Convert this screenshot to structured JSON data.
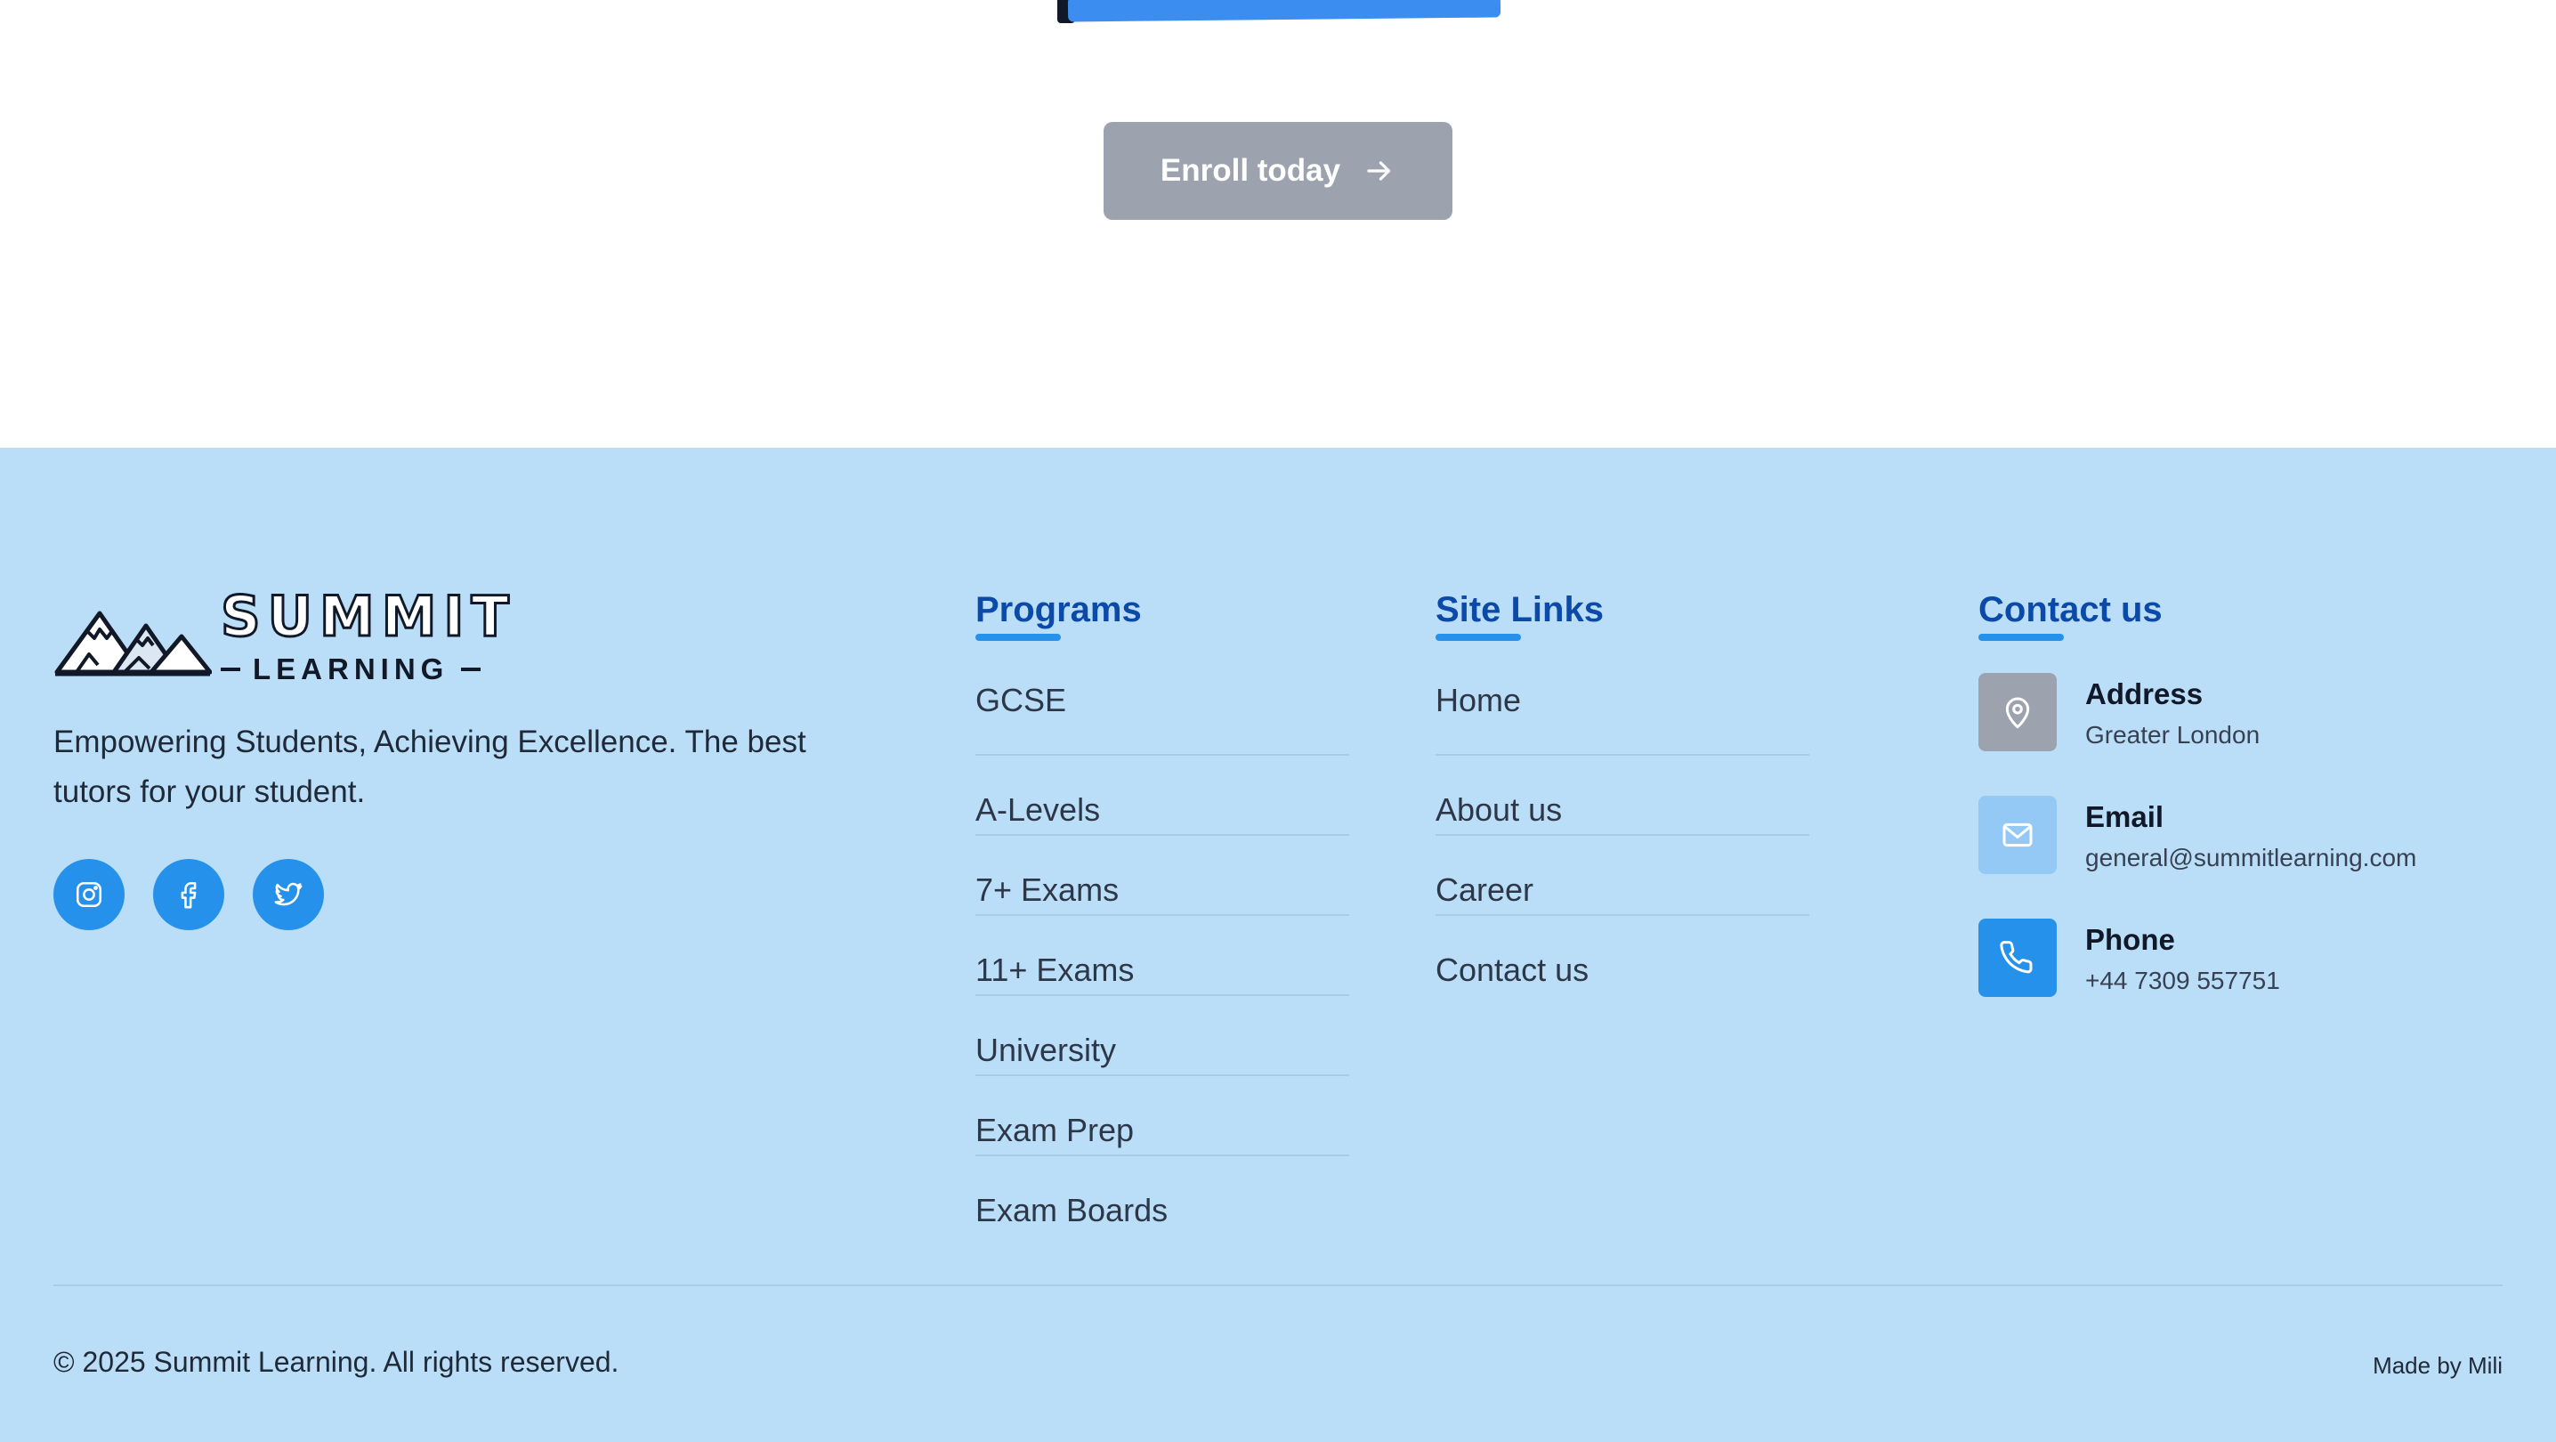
{
  "hero": {
    "enroll_label": "Enroll today"
  },
  "footer": {
    "brand": {
      "logo_line1": "SUMMIT",
      "logo_line2": "LEARNING",
      "tagline": "Empowering Students, Achieving Excellence. The best tutors for your student."
    },
    "socials": [
      {
        "icon": "instagram-icon"
      },
      {
        "icon": "facebook-icon"
      },
      {
        "icon": "twitter-icon"
      }
    ],
    "programs": {
      "title": "Programs",
      "items": [
        "GCSE",
        "A-Levels",
        "7+ Exams",
        "11+ Exams",
        "University",
        "Exam Prep",
        "Exam Boards"
      ]
    },
    "site_links": {
      "title": "Site Links",
      "items": [
        "Home",
        "About us",
        "Career",
        "Contact us"
      ]
    },
    "contact": {
      "title": "Contact us",
      "items": [
        {
          "label": "Address",
          "value": "Greater London",
          "icon": "location-pin-icon",
          "icon_bg": "#9ca3af"
        },
        {
          "label": "Email",
          "value": "general@summitlearning.com",
          "icon": "mail-icon",
          "icon_bg": "#93c9f4"
        },
        {
          "label": "Phone",
          "value": "+44 7309 557751",
          "icon": "phone-icon",
          "icon_bg": "#2591ea"
        }
      ]
    },
    "copyright": "© 2025 Summit Learning. All rights reserved.",
    "made_by": "Made by Mili"
  },
  "colors": {
    "footer_bg": "#bbdef8",
    "accent": "#2591ea",
    "heading": "#0b4aa8",
    "button_disabled": "#9ca3af"
  }
}
